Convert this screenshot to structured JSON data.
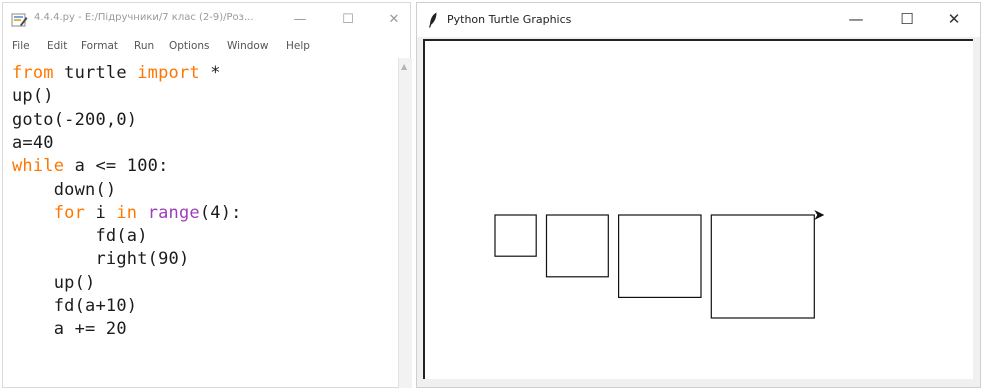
{
  "idle": {
    "title": "4.4.4.py - E:/Підручники/7 клас (2-9)/Роз...",
    "controls": {
      "minimize": "—",
      "maximize": "☐",
      "close": "✕"
    },
    "menu": [
      "File",
      "Edit",
      "Format",
      "Run",
      "Options",
      "Window",
      "Help"
    ],
    "code": [
      [
        {
          "t": "from",
          "c": "kw"
        },
        {
          "t": " turtle ",
          "c": ""
        },
        {
          "t": "import",
          "c": "kw"
        },
        {
          "t": " *",
          "c": ""
        }
      ],
      [
        {
          "t": "up()",
          "c": ""
        }
      ],
      [
        {
          "t": "goto(-200,0)",
          "c": ""
        }
      ],
      [
        {
          "t": "a=40",
          "c": ""
        }
      ],
      [
        {
          "t": "while",
          "c": "kw"
        },
        {
          "t": " a <= 100:",
          "c": ""
        }
      ],
      [
        {
          "t": "    down()",
          "c": ""
        }
      ],
      [
        {
          "t": "    ",
          "c": ""
        },
        {
          "t": "for",
          "c": "kw"
        },
        {
          "t": " i ",
          "c": ""
        },
        {
          "t": "in",
          "c": "kw"
        },
        {
          "t": " ",
          "c": ""
        },
        {
          "t": "range",
          "c": "bi"
        },
        {
          "t": "(4):",
          "c": ""
        }
      ],
      [
        {
          "t": "        fd(a)",
          "c": ""
        }
      ],
      [
        {
          "t": "        right(90)",
          "c": ""
        }
      ],
      [
        {
          "t": "    up()",
          "c": ""
        }
      ],
      [
        {
          "t": "    fd(a+10)",
          "c": ""
        }
      ],
      [
        {
          "t": "    a += 20",
          "c": ""
        }
      ]
    ],
    "colors": {
      "keyword": "#ff7700",
      "builtin": "#9c3fb8",
      "text": "#1c1c1c"
    }
  },
  "turtle": {
    "title": "Python Turtle Graphics",
    "controls": {
      "minimize": "—",
      "maximize": "☐",
      "close": "✕"
    },
    "squares": [
      {
        "side": 40
      },
      {
        "side": 60
      },
      {
        "side": 80
      },
      {
        "side": 100
      }
    ],
    "gap": 10,
    "start": [
      -200,
      0
    ],
    "heading": "east"
  }
}
